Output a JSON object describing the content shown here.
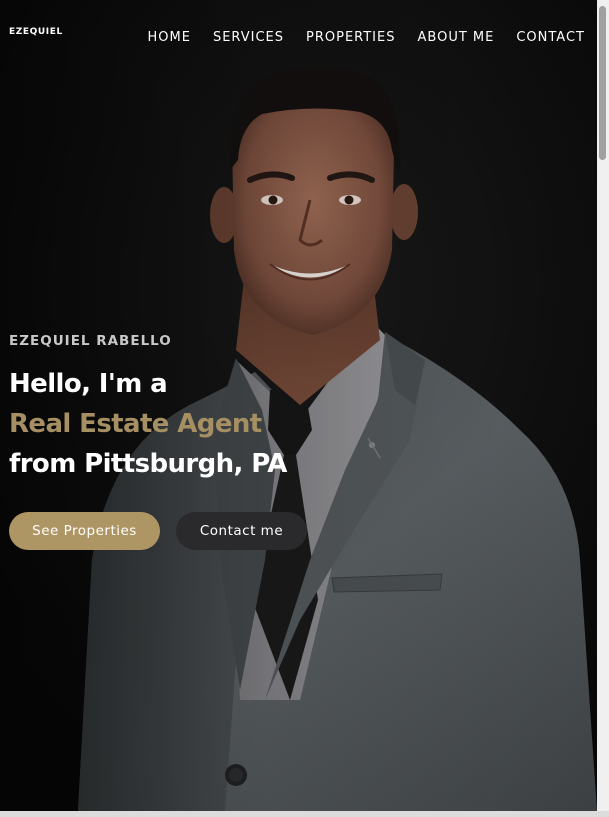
{
  "brand": {
    "logo": "EZEQUIEL"
  },
  "nav": {
    "items": [
      {
        "label": "HOME"
      },
      {
        "label": "SERVICES"
      },
      {
        "label": "PROPERTIES"
      },
      {
        "label": "ABOUT ME"
      },
      {
        "label": "CONTACT"
      }
    ]
  },
  "hero": {
    "eyebrow": "EZEQUIEL RABELLO",
    "headline_line1": "Hello, I'm a",
    "headline_line2": "Real Estate Agent",
    "headline_line3": "from Pittsburgh, PA",
    "primary_button": "See Properties",
    "secondary_button": "Contact me",
    "photo": "portrait of man in grey suit and black tie"
  },
  "colors": {
    "accent": "#a68f63",
    "primary_button": "#ae9564",
    "secondary_button": "#2a2a2c",
    "text": "#ffffff",
    "background": "#0d0d0d"
  }
}
